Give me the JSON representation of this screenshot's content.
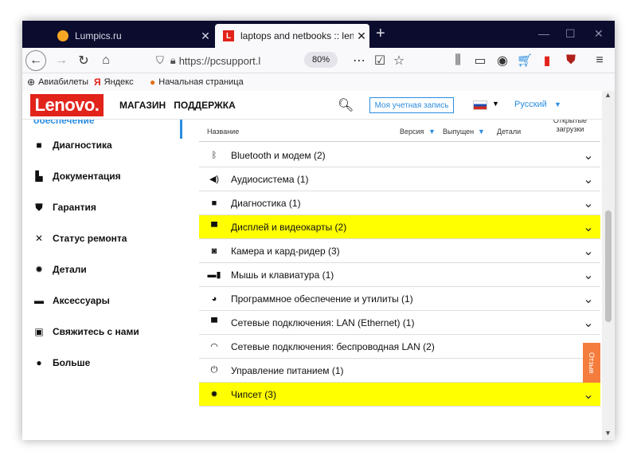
{
  "tabs": [
    {
      "title": "Lumpics.ru",
      "active": false
    },
    {
      "title": "laptops and netbooks :: lenovo",
      "active": true
    }
  ],
  "new_tab_label": "+",
  "window_controls": [
    "—",
    "☐",
    "✕"
  ],
  "nav": {
    "url": "https://pcsupport.l",
    "zoom": "80%"
  },
  "bookmarks": [
    "Авиабилеты",
    "Яндекс",
    "Начальная страница"
  ],
  "header": {
    "logo": "Lenovo.",
    "nav_items": [
      "МАГАЗИН",
      "ПОДДЕРЖКА"
    ],
    "account_button": "Моя учетная запись",
    "language": "Русский"
  },
  "sidebar": {
    "top_partial": "обеспечение",
    "items": [
      {
        "label": "Диагностика",
        "icon": "briefcase-icon"
      },
      {
        "label": "Документация",
        "icon": "document-icon"
      },
      {
        "label": "Гарантия",
        "icon": "shield-icon"
      },
      {
        "label": "Статус ремонта",
        "icon": "tools-icon"
      },
      {
        "label": "Детали",
        "icon": "gear-icon"
      },
      {
        "label": "Аксессуары",
        "icon": "keyboard-icon"
      },
      {
        "label": "Свяжитесь с нами",
        "icon": "contact-card-icon"
      },
      {
        "label": "Больше",
        "icon": "more-icon"
      }
    ]
  },
  "table": {
    "headers": {
      "name": "Название",
      "version": "Версия",
      "released": "Выпущен",
      "details": "Детали",
      "open": "Открытые загрузки"
    },
    "rows": [
      {
        "label": "Bluetooth и модем (2)",
        "icon": "bluetooth-icon",
        "highlighted": false
      },
      {
        "label": "Аудиосистема (1)",
        "icon": "speaker-icon",
        "highlighted": false
      },
      {
        "label": "Диагностика (1)",
        "icon": "briefcase-icon",
        "highlighted": false
      },
      {
        "label": "Дисплей и видеокарты (2)",
        "icon": "display-icon",
        "highlighted": true
      },
      {
        "label": "Камера и кард-ридер (3)",
        "icon": "camera-icon",
        "highlighted": false
      },
      {
        "label": "Мышь и клавиатура (1)",
        "icon": "mouse-icon",
        "highlighted": false
      },
      {
        "label": "Программное обеспечение и утилиты (1)",
        "icon": "software-icon",
        "highlighted": false
      },
      {
        "label": "Сетевые подключения: LAN (Ethernet) (1)",
        "icon": "ethernet-icon",
        "highlighted": false
      },
      {
        "label": "Сетевые подключения: беспроводная LAN (2)",
        "icon": "wifi-icon",
        "highlighted": false
      },
      {
        "label": "Управление питанием (1)",
        "icon": "power-icon",
        "highlighted": false
      },
      {
        "label": "Чипсет (3)",
        "icon": "chip-icon",
        "highlighted": true
      }
    ]
  },
  "feedback_label": "Отзыв",
  "colors": {
    "brand": "#e2231a",
    "accent": "#2b8de0",
    "highlight": "#ffff00"
  }
}
